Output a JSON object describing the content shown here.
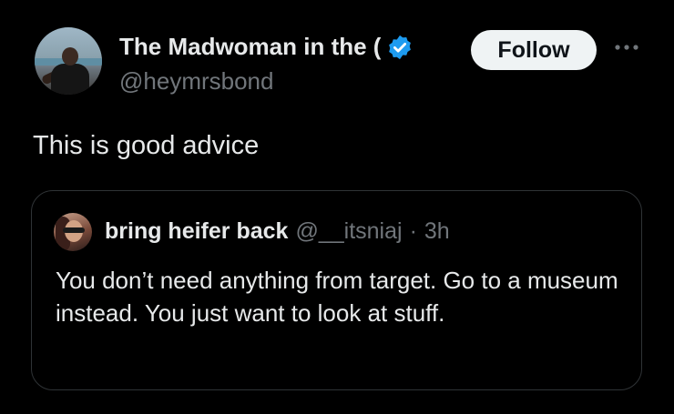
{
  "tweet": {
    "author": {
      "display_name": "The Madwoman in the (",
      "handle": "@heymrsbond",
      "verified": true
    },
    "follow_label": "Follow",
    "more_icon": "more-horizontal-icon",
    "text": "This is good advice"
  },
  "quote": {
    "author": {
      "display_name": "bring heifer back",
      "handle": "@__itsniaj",
      "separator": "·",
      "time": "3h"
    },
    "text": "You don’t need anything from target. Go to a museum instead. You just want to look at stuff."
  },
  "colors": {
    "background": "#000000",
    "text_primary": "#e7e9ea",
    "text_secondary": "#71767b",
    "verified_badge": "#1d9bf0",
    "follow_button_bg": "#eff3f4",
    "card_border": "#2f3336"
  }
}
